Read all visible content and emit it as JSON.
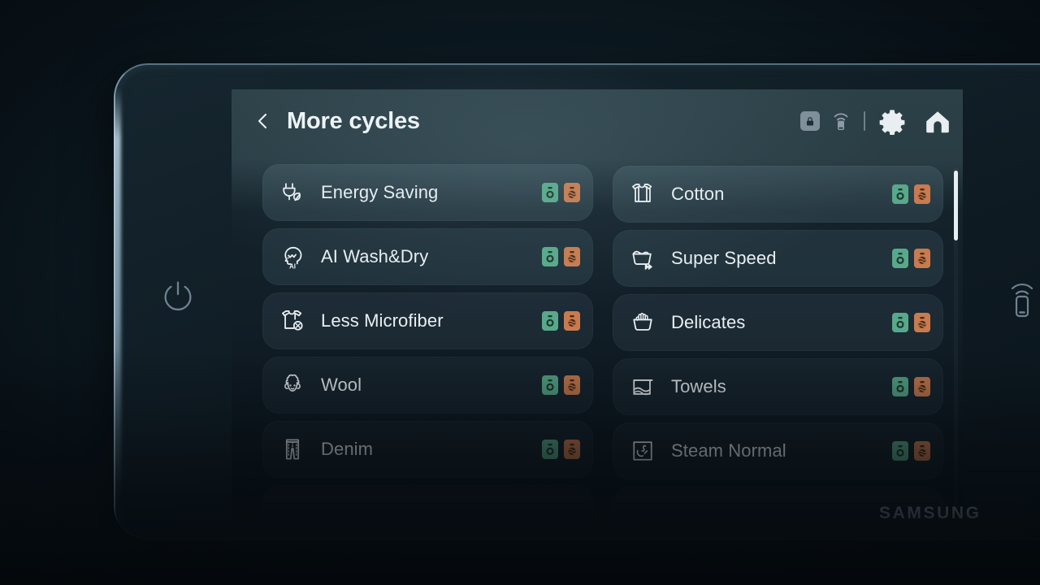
{
  "device": {
    "brand": "SAMSUNG",
    "power_button": "power-button",
    "smart_button": "smart-connect-button"
  },
  "header": {
    "back_label": "Back",
    "title": "More cycles",
    "icons": [
      {
        "name": "lock-icon",
        "label": "Child lock"
      },
      {
        "name": "remote-icon",
        "label": "Remote control"
      },
      {
        "name": "gear-icon",
        "label": "Settings"
      },
      {
        "name": "home-icon",
        "label": "Home"
      }
    ]
  },
  "cycles": {
    "left": [
      {
        "label": "Energy Saving",
        "icon": "plug-leaf-icon",
        "washer": true,
        "dryer": true
      },
      {
        "label": "AI Wash&Dry",
        "icon": "ai-head-icon",
        "washer": true,
        "dryer": true
      },
      {
        "label": "Less Microfiber",
        "icon": "shirt-microfiber-icon",
        "washer": true,
        "dryer": true
      },
      {
        "label": "Wool",
        "icon": "sheep-icon",
        "washer": true,
        "dryer": true
      },
      {
        "label": "Denim",
        "icon": "jeans-icon",
        "washer": true,
        "dryer": true
      },
      {
        "label": "",
        "icon": "",
        "washer": false,
        "dryer": false
      }
    ],
    "right": [
      {
        "label": "Cotton",
        "icon": "tshirt-icon",
        "washer": true,
        "dryer": true
      },
      {
        "label": "Super Speed",
        "icon": "basin-fast-icon",
        "washer": true,
        "dryer": true
      },
      {
        "label": "Delicates",
        "icon": "hand-wash-icon",
        "washer": true,
        "dryer": true
      },
      {
        "label": "Towels",
        "icon": "towel-icon",
        "washer": true,
        "dryer": true
      },
      {
        "label": "Steam Normal",
        "icon": "steam-icon",
        "washer": true,
        "dryer": true
      },
      {
        "label": "",
        "icon": "",
        "washer": false,
        "dryer": false
      }
    ]
  },
  "badges": {
    "washer_name": "washer-badge",
    "dryer_name": "dryer-badge",
    "washer_color": "#57a98a",
    "dryer_color": "#c87b4f"
  },
  "scrollbar": {
    "position": "top",
    "thumb_fraction": 0.2
  },
  "colors": {
    "screen_bg": "#101c25",
    "header_bg": "#2c4047",
    "text": "#e9eff3",
    "panel": "#122029"
  }
}
